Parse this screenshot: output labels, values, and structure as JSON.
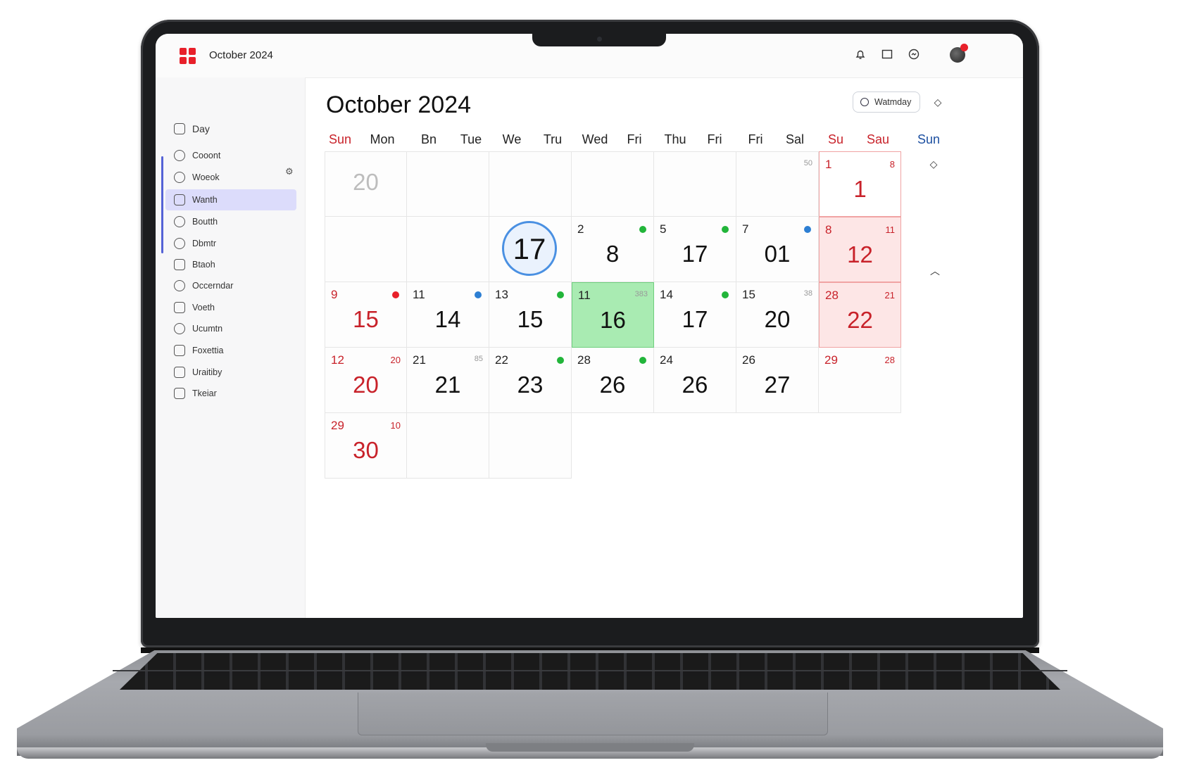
{
  "app": {
    "title": "October 2024"
  },
  "topbar": {
    "icons": [
      "bell-icon",
      "calendar-icon",
      "sync-icon",
      "avatar"
    ]
  },
  "sidebar": {
    "items": [
      {
        "label": "Day",
        "icon": "home-icon"
      },
      {
        "label": "Cooont",
        "icon": "clock-icon"
      },
      {
        "label": "Woeok",
        "icon": "clock-icon"
      },
      {
        "label": "Wanth",
        "icon": "calendar-icon",
        "active": true
      },
      {
        "label": "Boutth",
        "icon": "circle-icon"
      },
      {
        "label": "Dbmtr",
        "icon": "circle-icon"
      },
      {
        "label": "Btaoh",
        "icon": "calendar-icon"
      },
      {
        "label": "Occerndar",
        "icon": "clock-icon"
      },
      {
        "label": "Voeth",
        "icon": "calendar-icon"
      },
      {
        "label": "Ucumtn",
        "icon": "circle-icon"
      },
      {
        "label": "Foxettia",
        "icon": "calendar-icon"
      },
      {
        "label": "Uraitiby",
        "icon": "calendar-icon"
      },
      {
        "label": "Tkeiar",
        "icon": "calendar-icon"
      }
    ]
  },
  "main": {
    "title": "October 2024",
    "view_button": "Watmday",
    "weekdays": [
      {
        "label": "Sun",
        "color": "red"
      },
      {
        "label": "Mon"
      },
      {
        "label": "Bn"
      },
      {
        "label": "Tue"
      },
      {
        "label": "We"
      },
      {
        "label": "Tru"
      },
      {
        "label": "Wed"
      },
      {
        "label": "Fri"
      },
      {
        "label": "Thu"
      },
      {
        "label": "Fri"
      },
      {
        "label": "Fri"
      },
      {
        "label": "Sal"
      },
      {
        "label": "Su",
        "color": "red"
      },
      {
        "label": "Sau",
        "color": "red"
      },
      {
        "label": "Sun",
        "color": "blue"
      }
    ],
    "cells": [
      [
        {
          "big": "20",
          "style": "grey"
        },
        {},
        {},
        {},
        {},
        {
          "mark": "50"
        },
        {
          "small": "1",
          "big": "1",
          "mark": "8",
          "style": "pink-light",
          "red": true
        }
      ],
      [
        {},
        {},
        {
          "today": "17"
        },
        {
          "small": "2",
          "big": "8",
          "dot": "#22b53a"
        },
        {
          "small": "5",
          "big": "17",
          "dot": "#22b53a"
        },
        {
          "small": "7",
          "big": "01",
          "dot": "#2d7fd3"
        },
        {
          "small": "8",
          "big": "12",
          "mark": "11",
          "style": "pink",
          "red": true
        }
      ],
      [
        {
          "small": "9",
          "big": "15",
          "dot": "#e8202a",
          "red": true
        },
        {
          "small": "11",
          "big": "14",
          "dot": "#2d7fd3"
        },
        {
          "small": "13",
          "big": "15",
          "dot": "#22b53a"
        },
        {
          "small": "11",
          "big": "16",
          "mark": "383",
          "style": "green"
        },
        {
          "small": "14",
          "big": "17",
          "dot": "#22b53a"
        },
        {
          "small": "15",
          "big": "20",
          "mark": "38"
        },
        {
          "small": "28",
          "big": "22",
          "mark": "21",
          "style": "pink",
          "red": true
        }
      ],
      [
        {
          "small": "12",
          "big": "20",
          "mark": "20",
          "red": true
        },
        {
          "small": "21",
          "big": "21",
          "mark": "85"
        },
        {
          "small": "22",
          "big": "23",
          "dot": "#22b53a"
        },
        {
          "small": "28",
          "big": "26",
          "dot": "#22b53a"
        },
        {
          "small": "24",
          "big": "26"
        },
        {
          "small": "26",
          "big": "27"
        },
        {
          "small": "29",
          "mark": "28",
          "red": true
        }
      ],
      [
        {
          "small": "29",
          "big": "30",
          "mark": "10",
          "red": true
        },
        {},
        {}
      ]
    ]
  },
  "colors": {
    "accent": "#e8202a",
    "today": "#4a90e2",
    "selected": "#a9ebb2",
    "weekend": "#fde6e6"
  }
}
